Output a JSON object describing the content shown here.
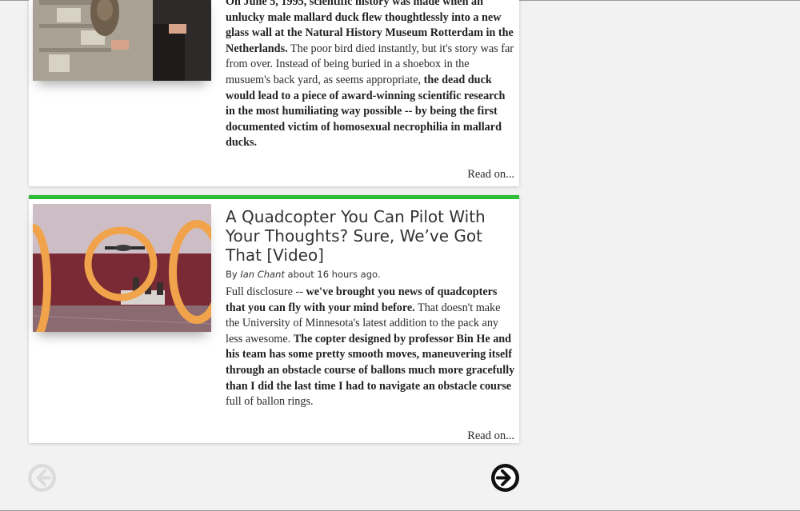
{
  "card1": {
    "body": [
      {
        "b": true,
        "t": "On June 5, 1995, scientific history was made when an unlucky male mallard duck flew thoughtlessly into a new glass wall at the Natural History Museum Rotterdam in the Netherlands."
      },
      {
        "b": false,
        "t": " The poor bird died instantly, but it's story was far from over. Instead of being buried in a shoebox in the musuem's back yard, as seems appropriate, "
      },
      {
        "b": true,
        "t": "the dead duck would lead to a piece of award-winning scientific research in the most humiliating way possible -- by being the first documented victim of homosexual necrophilia in mallard ducks."
      }
    ],
    "read_on": "Read on..."
  },
  "card2": {
    "title": "A Quadcopter You Can Pilot With Your Thoughts? Sure, We’ve Got That [Video]",
    "byline_prefix": "By ",
    "author": "Ian Chant",
    "byline_suffix": " about 16 hours ago.",
    "body": [
      {
        "b": false,
        "t": "Full disclosure -- "
      },
      {
        "b": true,
        "t": "we've brought you news of quadcopters that you can fly with your mind before."
      },
      {
        "b": false,
        "t": " That doesn't make the University of Minnesota's latest addition to the pack any less awesome. "
      },
      {
        "b": true,
        "t": "The copter designed by professor Bin He and his team has some pretty smooth moves, maneuvering itself through an obstacle course of ballons much more gracefully than I did the last time I had to navigate an obstacle course"
      },
      {
        "b": false,
        "t": " full of ballon rings."
      }
    ],
    "read_on": "Read on...",
    "accent_color": "#2fbe3a"
  },
  "nav": {
    "prev_icon": "arrow-left-circle-icon",
    "next_icon": "arrow-right-circle-icon"
  }
}
